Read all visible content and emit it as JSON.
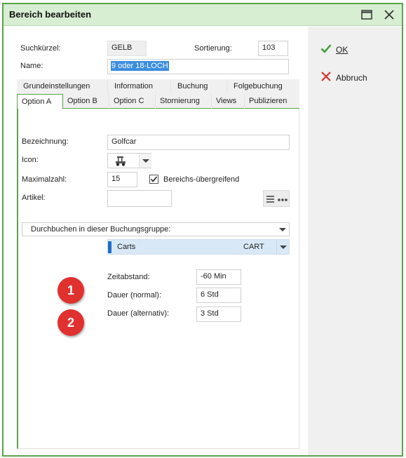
{
  "window": {
    "title": "Bereich bearbeiten"
  },
  "actions": {
    "ok_label": "OK",
    "abort_label": "Abbruch"
  },
  "header": {
    "short_label": "Suchkürzel:",
    "short_value": "GELB",
    "sort_label": "Sortierung:",
    "sort_value": "103",
    "name_label": "Name:",
    "name_value": "9 oder 18-LOCH"
  },
  "tabs_row1": [
    "Grundeinstellungen",
    "Information",
    "Buchung",
    "Folgebuchung"
  ],
  "tabs_row2": [
    "Option A",
    "Option B",
    "Option C",
    "Stornierung",
    "Views",
    "Publizieren"
  ],
  "form": {
    "bezeichnung_label": "Bezeichnung:",
    "bezeichnung_value": "Golfcar",
    "icon_label": "Icon:",
    "maximalzahl_label": "Maximalzahl:",
    "maximalzahl_value": "15",
    "cross_checkbox_label": "Bereichs-übergreifend",
    "artikel_label": "Artikel:",
    "artikel_value": "",
    "group_dropdown": "Durchbuchen in dieser Buchungsgruppe:",
    "carts_name": "Carts",
    "carts_code": "CART",
    "zeitabstand_label": "Zeitabstand:",
    "zeitabstand_value": "-60 Min",
    "dauer_normal_label": "Dauer (normal):",
    "dauer_normal_value": "6 Std",
    "dauer_alt_label": "Dauer (alternativ):",
    "dauer_alt_value": "3 Std"
  },
  "badges": [
    "1",
    "2"
  ],
  "colors": {
    "accent": "#5aa44a",
    "title_bg": "#d7eed3",
    "badge": "#e0312f",
    "selection": "#3c8dde",
    "carts_bg": "#d9e8f6"
  }
}
